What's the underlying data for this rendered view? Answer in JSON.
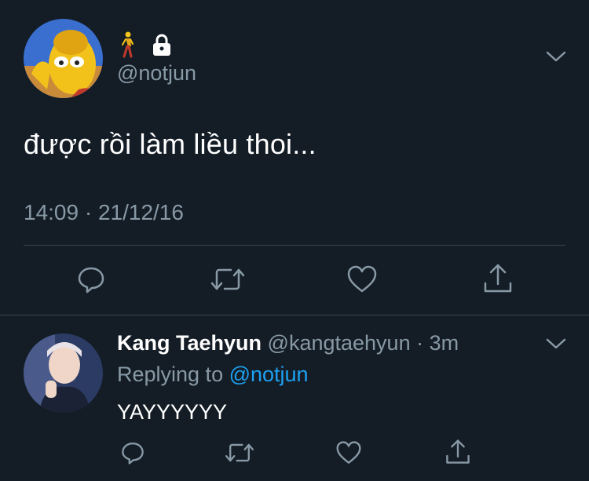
{
  "tweet": {
    "author_handle": "@notjun",
    "author_emoji_icons": [
      "person-walking-icon",
      "lock-icon"
    ],
    "text": "được rồi làm liều thoi...",
    "timestamp": "14:09 · 21/12/16",
    "actions": [
      "reply-icon",
      "retweet-icon",
      "like-icon",
      "share-icon"
    ]
  },
  "reply": {
    "author_name": "Kang Taehyun",
    "author_handle": "@kangtaehyun",
    "separator": " · ",
    "time_ago": "3m",
    "replying_prefix": "Replying to ",
    "replying_to": "@notjun",
    "text": "YAYYYYYY",
    "actions": [
      "reply-icon",
      "retweet-icon",
      "like-icon",
      "share-icon"
    ]
  },
  "colors": {
    "background": "#141d26",
    "text_primary": "#ffffff",
    "text_secondary": "#8899a6",
    "link": "#1da1f2",
    "divider": "#38444d"
  }
}
